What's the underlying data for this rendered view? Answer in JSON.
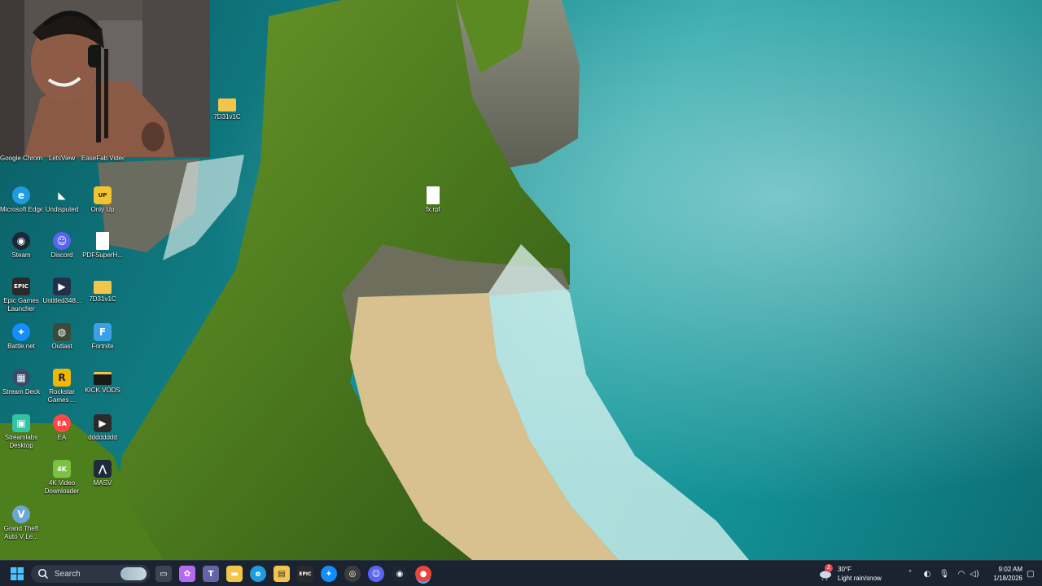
{
  "desktop": {
    "icons": [
      {
        "id": "google-chrome",
        "label": "Google Chrome",
        "icon": "chrome-icon",
        "color": "#e8453c"
      },
      {
        "id": "letsview",
        "label": "LetsView",
        "icon": "letsview-icon",
        "color": "#2d7ff9"
      },
      {
        "id": "easefab",
        "label": "EaseFab Video C...",
        "icon": "easefab-icon",
        "color": "#f28b22"
      },
      {
        "id": "microsoft-edge",
        "label": "Microsoft Edge",
        "icon": "edge-icon",
        "color": "#1f9be0"
      },
      {
        "id": "undisputed",
        "label": "Undisputed",
        "icon": "undisputed-icon",
        "color": "#cfcfcf"
      },
      {
        "id": "only-up",
        "label": "Only Up",
        "icon": "only-up-icon",
        "color": "#f4c430"
      },
      {
        "id": "steam",
        "label": "Steam",
        "icon": "steam-icon",
        "color": "#1b2838"
      },
      {
        "id": "discord",
        "label": "Discord",
        "icon": "discord-icon",
        "color": "#5865f2"
      },
      {
        "id": "pdfsuper",
        "label": "PDFSuperH...",
        "icon": "file-icon",
        "color": "#ffffff"
      },
      {
        "id": "epic-games",
        "label": "Epic Games Launcher",
        "icon": "epic-games-icon",
        "color": "#2a2a2a"
      },
      {
        "id": "untitled",
        "label": "Untitled348...",
        "icon": "video-file-icon",
        "color": "#24304a"
      },
      {
        "id": "folder-7d31v1c-b",
        "label": "7D31v1C",
        "icon": "folder-icon",
        "color": "#f3c54b"
      },
      {
        "id": "battle-net",
        "label": "Battle.net",
        "icon": "battlenet-icon",
        "color": "#148eff"
      },
      {
        "id": "outlast",
        "label": "Outlast",
        "icon": "outlast-icon",
        "color": "#3c4a3a"
      },
      {
        "id": "fortnite",
        "label": "Fortnite",
        "icon": "fortnite-icon",
        "color": "#3aa0e8"
      },
      {
        "id": "stream-deck",
        "label": "Stream Deck",
        "icon": "stream-deck-icon",
        "color": "#3a4a6a"
      },
      {
        "id": "rockstar",
        "label": "Rockstar Games ...",
        "icon": "rockstar-icon",
        "color": "#f2b705"
      },
      {
        "id": "kick-vods",
        "label": "KICK VODS",
        "icon": "folder-icon",
        "color": "#1a1a1a"
      },
      {
        "id": "streamlabs",
        "label": "Streamlabs Desktop",
        "icon": "streamlabs-icon",
        "color": "#31c3a2"
      },
      {
        "id": "ea",
        "label": "EA",
        "icon": "ea-icon",
        "color": "#ff4747"
      },
      {
        "id": "dddddddd",
        "label": "dddddddd",
        "icon": "video-file-icon",
        "color": "#2b2b2b"
      },
      {
        "id": "4k-video",
        "label": "4K Video Downloader",
        "icon": "4k-video-icon",
        "color": "#7bc142"
      },
      {
        "id": "masv",
        "label": "MASV",
        "icon": "masv-icon",
        "color": "#1f2a3a"
      },
      {
        "id": "gta",
        "label": "Grand Theft Auto V Le...",
        "icon": "gta-icon",
        "color": "#6aa7d4"
      },
      {
        "id": "folder-7d31v1c-a",
        "label": "7D31v1C",
        "icon": "folder-icon",
        "color": "#f3c54b"
      },
      {
        "id": "fx-rpf",
        "label": "fx.rpf",
        "icon": "file-icon",
        "color": "#ffffff"
      }
    ]
  },
  "taskbar": {
    "search_placeholder": "Search",
    "apps": [
      {
        "id": "task-view",
        "icon": "task-view-icon",
        "color": "#3a4454"
      },
      {
        "id": "copilot",
        "icon": "copilot-icon",
        "color": "#b36bf0"
      },
      {
        "id": "teams",
        "icon": "teams-icon",
        "color": "#6264a7"
      },
      {
        "id": "file-explorer",
        "icon": "folder-icon",
        "color": "#f3c54b"
      },
      {
        "id": "edge",
        "icon": "edge-icon",
        "color": "#1f9be0"
      },
      {
        "id": "store",
        "icon": "store-icon",
        "color": "#f3c54b"
      },
      {
        "id": "epic-games",
        "icon": "epic-games-icon",
        "color": "#2a2a2a"
      },
      {
        "id": "battle-net",
        "icon": "battlenet-icon",
        "color": "#148eff"
      },
      {
        "id": "obs",
        "icon": "obs-icon",
        "color": "#3c3c3c"
      },
      {
        "id": "discord",
        "icon": "discord-icon",
        "color": "#5865f2"
      },
      {
        "id": "steam",
        "icon": "steam-icon",
        "color": "#1b2838"
      },
      {
        "id": "chrome",
        "icon": "chrome-icon",
        "color": "#e8453c"
      }
    ],
    "weather": {
      "temp": "30°F",
      "desc": "Light rain/snow",
      "badge": "2"
    },
    "clock": {
      "time": "9:02 AM",
      "date": "1/18/2026"
    }
  }
}
